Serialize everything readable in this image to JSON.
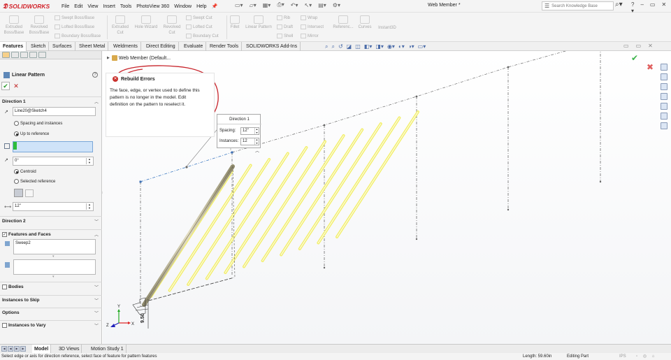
{
  "app": {
    "name": "SOLIDWORKS",
    "document_title": "Web Member *"
  },
  "menu": [
    "File",
    "Edit",
    "View",
    "Insert",
    "Tools",
    "PhotoView 360",
    "Window",
    "Help"
  ],
  "search": {
    "placeholder": "Search Knowledge Base"
  },
  "commands": {
    "extruded_boss": "Extruded Boss/Base",
    "revolved_boss": "Revolved Boss/Base",
    "swept_boss": "Swept Boss/Base",
    "lofted_boss": "Lofted Boss/Base",
    "boundary_boss": "Boundary Boss/Base",
    "extruded_cut": "Extruded Cut",
    "hole_wizard": "Hole Wizard",
    "revolved_cut": "Revolved Cut",
    "swept_cut": "Swept Cut",
    "lofted_cut": "Lofted Cut",
    "boundary_cut": "Boundary Cut",
    "fillet": "Fillet",
    "linear_pattern": "Linear Pattern",
    "rib": "Rib",
    "draft": "Draft",
    "shell": "Shell",
    "wrap": "Wrap",
    "intersect": "Intersect",
    "mirror": "Mirror",
    "reference": "Referenc...",
    "curves": "Curves",
    "instant3d": "Instant3D"
  },
  "tabs": [
    "Features",
    "Sketch",
    "Surfaces",
    "Sheet Metal",
    "Weldments",
    "Direct Editing",
    "Evaluate",
    "Render Tools",
    "SOLIDWORKS Add-Ins"
  ],
  "property_manager": {
    "title": "Linear Pattern",
    "direction1": {
      "label": "Direction 1",
      "edge": "Line20@Sketch4",
      "opt_spacing": "Spacing and instances",
      "opt_up_to": "Up to reference",
      "angle": "0°",
      "opt_centroid": "Centroid",
      "opt_selected": "Selected reference",
      "spacing": "12\""
    },
    "direction2": {
      "label": "Direction 2"
    },
    "features_faces": {
      "label": "Features and Faces",
      "item": "Sweep2"
    },
    "bodies": "Bodies",
    "instances_to_skip": "Instances to Skip",
    "options": "Options",
    "instances_to_vary": "Instances to Vary"
  },
  "tree": {
    "label": "Web Member  (Default..."
  },
  "rebuild_error": {
    "title": "Rebuild Errors",
    "message": "The face, edge, or vertex used to define this pattern is no longer in the model. Edit definition on the pattern to reselect it."
  },
  "direction_callout": {
    "title": "Direction 1",
    "spacing_label": "Spacing:",
    "spacing_value": "12\"",
    "instances_label": "Instances:",
    "instances_value": "12"
  },
  "triad": {
    "x": "X",
    "y": "Y",
    "z": "Z"
  },
  "bottom_tabs": [
    "Model",
    "3D Views",
    "Motion Study 1"
  ],
  "status": {
    "message": "Select edge or axis for direction reference, select face of feature for pattern features",
    "length": "Length: 59.60in",
    "mode": "Editing Part",
    "units": "IPS"
  },
  "colors": {
    "brand": "#d2232a",
    "preview": "#f2ee5c",
    "annotation": "#c8252c",
    "accept": "#3cb44b"
  },
  "icons": [
    "cube-icon",
    "arrow-icon",
    "gear-icon",
    "search-icon",
    "help-icon",
    "close-icon",
    "check-icon"
  ]
}
